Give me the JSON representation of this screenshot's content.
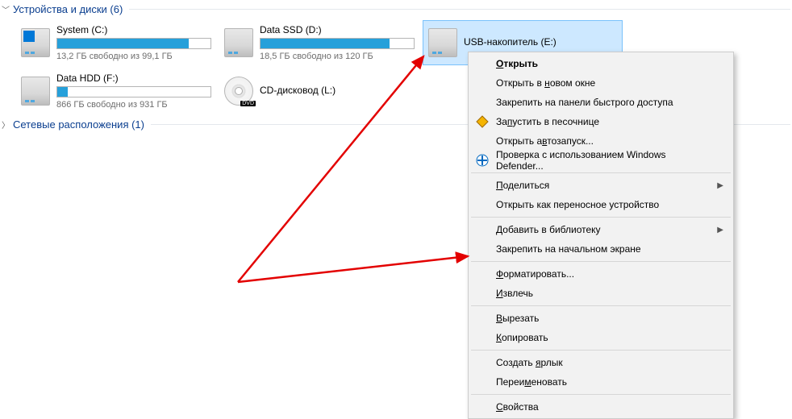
{
  "sections": {
    "devices": {
      "label": "Устройства и диски (6)"
    },
    "network": {
      "label": "Сетевые расположения (1)"
    }
  },
  "drives": {
    "system": {
      "name": "System (C:)",
      "sub": "13,2 ГБ свободно из 99,1 ГБ",
      "fill_pct": 86
    },
    "datassd": {
      "name": "Data SSD (D:)",
      "sub": "18,5 ГБ свободно из 120 ГБ",
      "fill_pct": 84
    },
    "usb": {
      "name": "USB-накопитель (E:)"
    },
    "datahdd": {
      "name": "Data HDD (F:)",
      "sub": "866 ГБ свободно из 931 ГБ",
      "fill_pct": 7
    },
    "dvd": {
      "name": "CD-дисковод (L:)"
    }
  },
  "context_menu": {
    "open": "Открыть",
    "open_new_window": "Открыть в новом окне",
    "pin_quick_access": "Закрепить на панели быстрого доступа",
    "run_sandbox": "Запустить в песочнице",
    "open_autorun": "Открыть автозапуск...",
    "defender": "Проверка с использованием Windows Defender...",
    "share": "Поделиться",
    "open_portable": "Открыть как переносное устройство",
    "add_library": "Добавить в библиотеку",
    "pin_start": "Закрепить на начальном экране",
    "format": "Форматировать...",
    "eject": "Извлечь",
    "cut": "Вырезать",
    "copy": "Копировать",
    "create_shortcut": "Создать ярлык",
    "rename": "Переименовать",
    "properties": "Свойства",
    "mnemonics": {
      "open": "О",
      "new_window": "н",
      "sandbox": "п",
      "autorun": "в",
      "share": "П",
      "library": "Д",
      "format": "Ф",
      "eject": "И",
      "cut": "В",
      "copy": "К",
      "shortcut": "я",
      "rename": "м",
      "properties": "С"
    }
  }
}
